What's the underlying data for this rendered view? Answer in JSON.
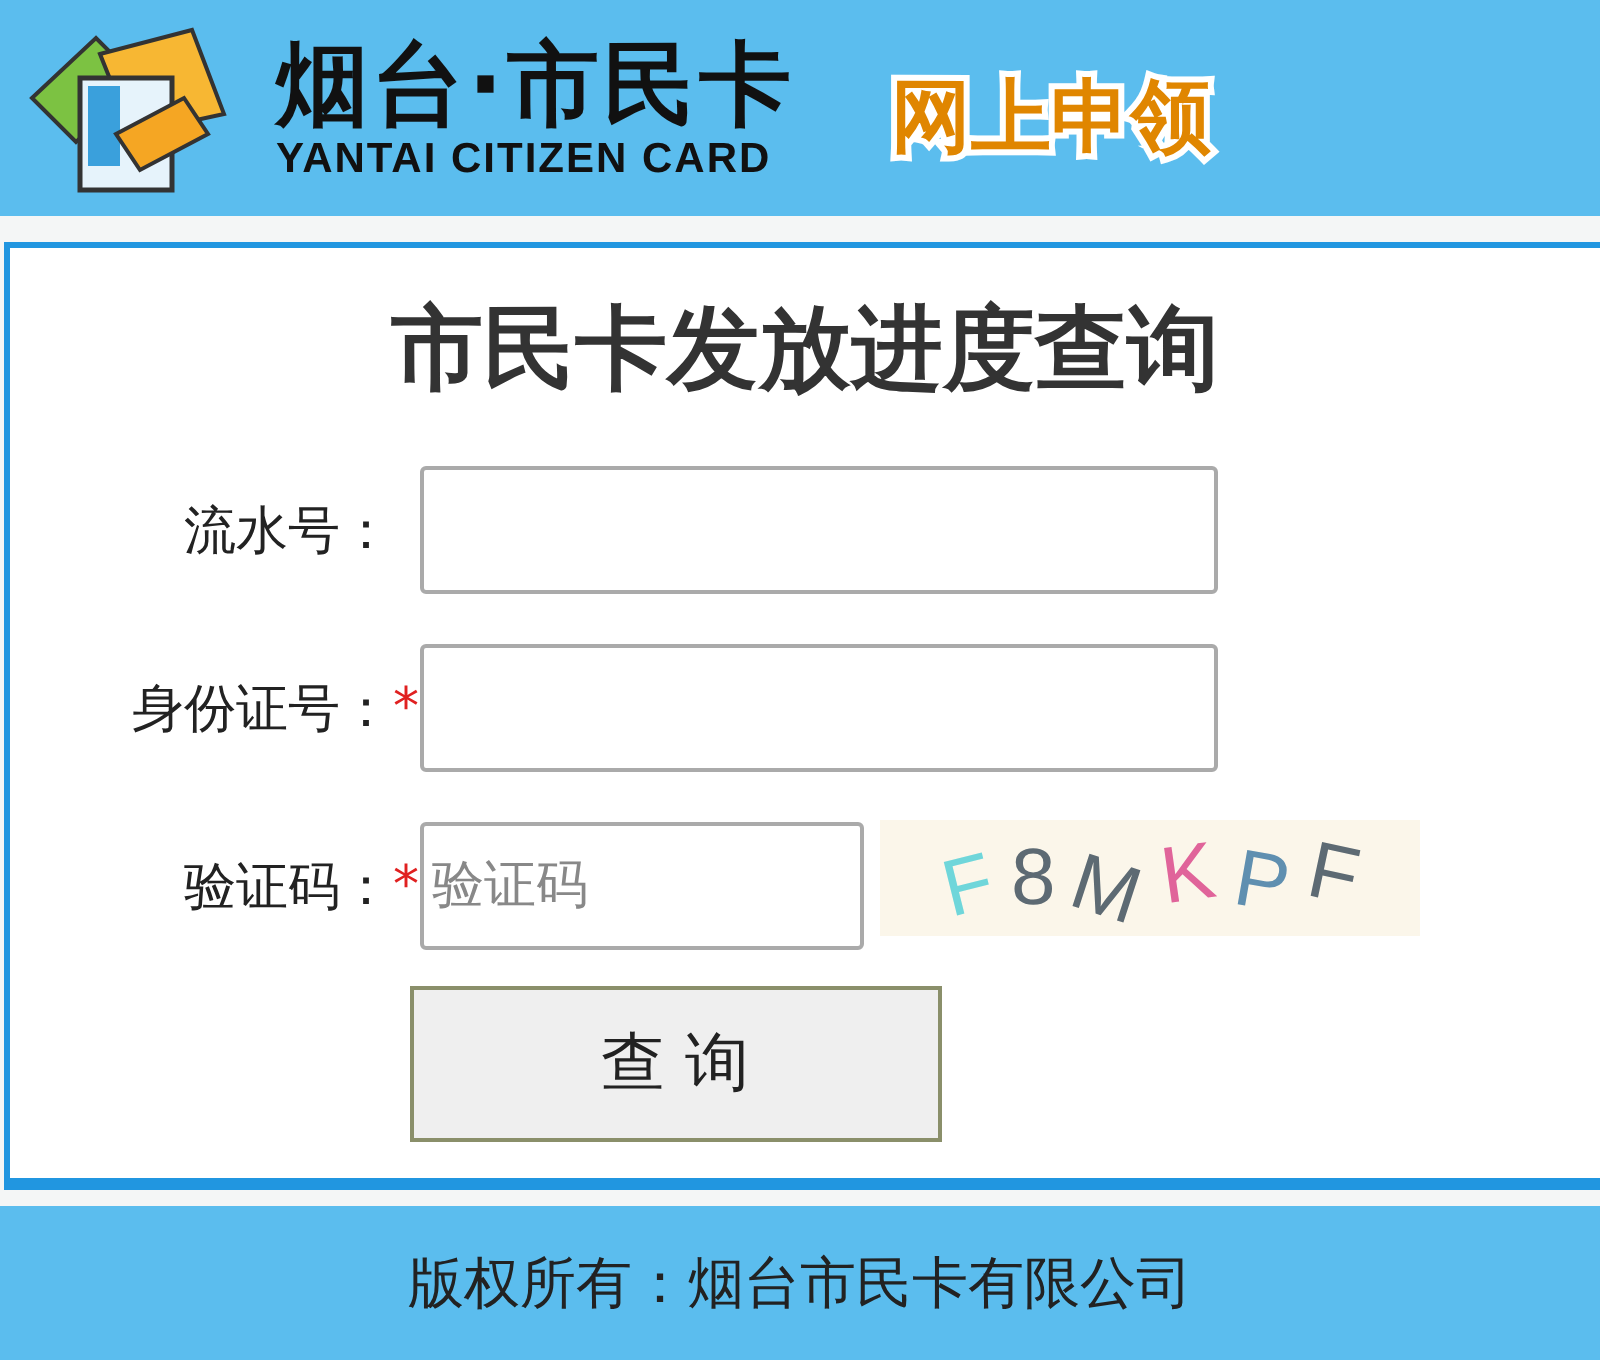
{
  "header": {
    "logo_title": "烟台·市民卡",
    "logo_subtitle": "YANTAI CITIZEN CARD",
    "tagline": "网上申领"
  },
  "form": {
    "title": "市民卡发放进度查询",
    "fields": [
      {
        "kind": "text",
        "label": "流水号："
      },
      {
        "kind": "text",
        "label": "身份证号：",
        "required_mark": "*"
      },
      {
        "kind": "captcha",
        "label": "验证码：",
        "required_mark": "*",
        "placeholder": "验证码",
        "captcha": [
          {
            "char": "F",
            "color": "#6fd6da"
          },
          {
            "char": "8",
            "color": "#5d6a73"
          },
          {
            "char": "M",
            "color": "#5d6a73"
          },
          {
            "char": "K",
            "color": "#e0649a"
          },
          {
            "char": "P",
            "color": "#5f8fb0"
          },
          {
            "char": "F",
            "color": "#5d6a73"
          }
        ]
      }
    ],
    "submit": "查 询"
  },
  "footer": {
    "copyright": "版权所有：烟台市民卡有限公司"
  }
}
